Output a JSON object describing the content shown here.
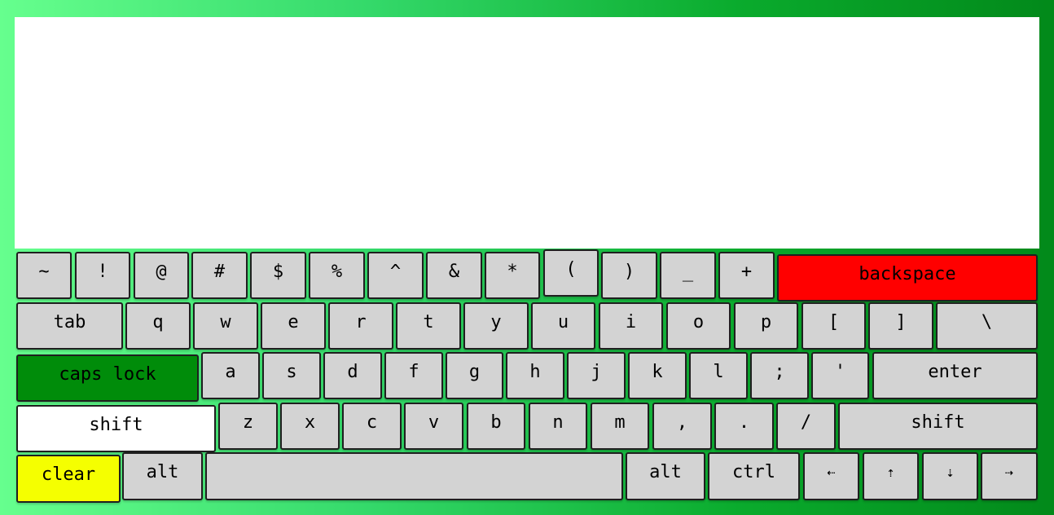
{
  "colors": {
    "backspace": "#ff0000",
    "caps_lock_active": "#008c0a",
    "shift_active": "#ffffff",
    "clear": "#f5ff00",
    "key_default": "#d3d3d3"
  },
  "text_area": {
    "value": ""
  },
  "keys": {
    "tilde": "~",
    "excl": "!",
    "at": "@",
    "hash": "#",
    "dollar": "$",
    "percent": "%",
    "caret": "^",
    "amp": "&",
    "star": "*",
    "lparen": "(",
    "rparen": ")",
    "underscore": "_",
    "plus": "+",
    "backspace": "backspace",
    "tab": "tab",
    "q": "q",
    "w": "w",
    "e": "e",
    "r": "r",
    "t": "t",
    "y": "y",
    "u": "u",
    "i": "i",
    "o": "o",
    "p": "p",
    "lbracket": "[",
    "rbracket": "]",
    "backslash": "\\",
    "caps_lock": "caps lock",
    "a": "a",
    "s": "s",
    "d": "d",
    "f": "f",
    "g": "g",
    "h": "h",
    "j": "j",
    "k": "k",
    "l": "l",
    "semicolon": ";",
    "quote": "'",
    "enter": "enter",
    "shift_left": "shift",
    "z": "z",
    "x": "x",
    "c": "c",
    "v": "v",
    "b": "b",
    "n": "n",
    "m": "m",
    "comma": ",",
    "period": ".",
    "slash": "/",
    "shift_right": "shift",
    "clear": "clear",
    "alt_left": "alt",
    "space": "",
    "alt_right": "alt",
    "ctrl": "ctrl",
    "left": "⇠",
    "up": "⇡",
    "down": "⇣",
    "right": "⇢"
  }
}
